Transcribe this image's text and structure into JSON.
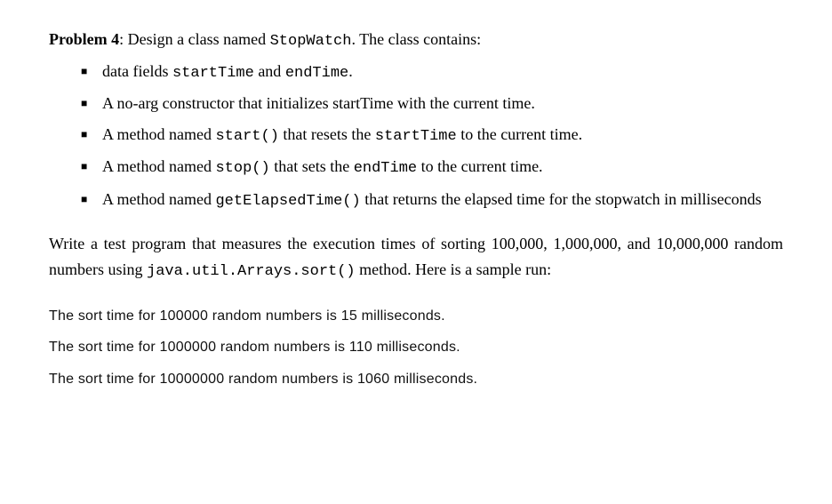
{
  "header": {
    "label": "Problem 4",
    "intro_pre": ": Design a class named ",
    "classname": "StopWatch",
    "intro_post": ". The class contains:"
  },
  "bullets": [
    {
      "segments": [
        {
          "text": "data fields ",
          "code": false
        },
        {
          "text": "startTime",
          "code": true
        },
        {
          "text": " and ",
          "code": false
        },
        {
          "text": "endTime",
          "code": true
        },
        {
          "text": ".",
          "code": false
        }
      ]
    },
    {
      "segments": [
        {
          "text": "A no-arg constructor that initializes startTime with the current time.",
          "code": false
        }
      ]
    },
    {
      "segments": [
        {
          "text": "A method named ",
          "code": false
        },
        {
          "text": "start()",
          "code": true
        },
        {
          "text": " that resets the ",
          "code": false
        },
        {
          "text": "startTime",
          "code": true
        },
        {
          "text": " to the current time.",
          "code": false
        }
      ]
    },
    {
      "segments": [
        {
          "text": "A method named ",
          "code": false
        },
        {
          "text": "stop()",
          "code": true
        },
        {
          "text": " that sets the ",
          "code": false
        },
        {
          "text": "endTime",
          "code": true
        },
        {
          "text": " to the current time.",
          "code": false
        }
      ]
    },
    {
      "segments": [
        {
          "text": "A method named ",
          "code": false
        },
        {
          "text": "getElapsedTime()",
          "code": true
        },
        {
          "text": " that returns the elapsed time for the stopwatch in milliseconds",
          "code": false
        }
      ]
    }
  ],
  "test_paragraph": {
    "pre": "Write a test program that measures the execution times of sorting 100,000, 1,000,000, and 10,000,000 random numbers using ",
    "code": "java.util.Arrays.sort()",
    "post": " method. Here is a sample run:"
  },
  "output": [
    "The sort time for 100000 random numbers is 15 milliseconds.",
    "The sort time for 1000000 random numbers is 110 milliseconds.",
    "The sort time for 10000000 random numbers is 1060 milliseconds."
  ]
}
